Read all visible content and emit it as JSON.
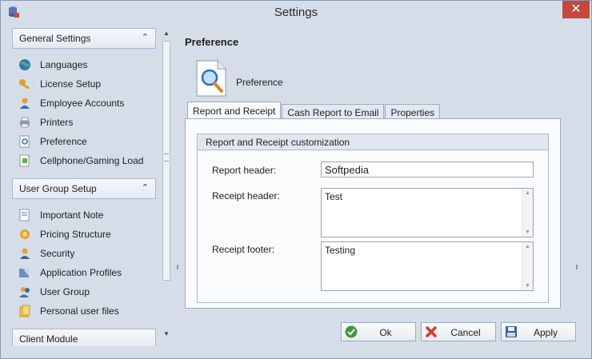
{
  "window": {
    "title": "Settings",
    "close_label": "✕"
  },
  "sidebar": {
    "groups": [
      {
        "label": "General Settings",
        "items": [
          {
            "label": "Languages",
            "icon": "globe-icon"
          },
          {
            "label": "License Setup",
            "icon": "key-icon"
          },
          {
            "label": "Employee Accounts",
            "icon": "user-icon"
          },
          {
            "label": "Printers",
            "icon": "printer-icon"
          },
          {
            "label": "Preference",
            "icon": "preference-icon"
          },
          {
            "label": "Cellphone/Gaming Load",
            "icon": "phone-icon"
          }
        ]
      },
      {
        "label": "User Group Setup",
        "items": [
          {
            "label": "Important Note",
            "icon": "note-icon"
          },
          {
            "label": "Pricing Structure",
            "icon": "pricing-icon"
          },
          {
            "label": "Security",
            "icon": "security-icon"
          },
          {
            "label": "Application Profiles",
            "icon": "profiles-icon"
          },
          {
            "label": "User Group",
            "icon": "users-icon"
          },
          {
            "label": "Personal user files",
            "icon": "files-icon"
          }
        ]
      },
      {
        "label": "Client Module",
        "items": []
      }
    ]
  },
  "main": {
    "section_title": "Preference",
    "icon_label": "Preference",
    "tabs": [
      {
        "label": "Report and Receipt",
        "active": true
      },
      {
        "label": "Cash Report to Email",
        "active": false
      },
      {
        "label": "Properties",
        "active": false
      }
    ],
    "group_title": "Report and Receipt customization",
    "fields": {
      "report_header": {
        "label": "Report header:",
        "value": "Softpedia"
      },
      "receipt_header": {
        "label": "Receipt header:",
        "value": "Test"
      },
      "receipt_footer": {
        "label": "Receipt footer:",
        "value": "Testing"
      }
    }
  },
  "buttons": {
    "ok": "Ok",
    "cancel": "Cancel",
    "apply": "Apply"
  },
  "colors": {
    "accent": "#2f6fb7",
    "close": "#c7463d"
  }
}
